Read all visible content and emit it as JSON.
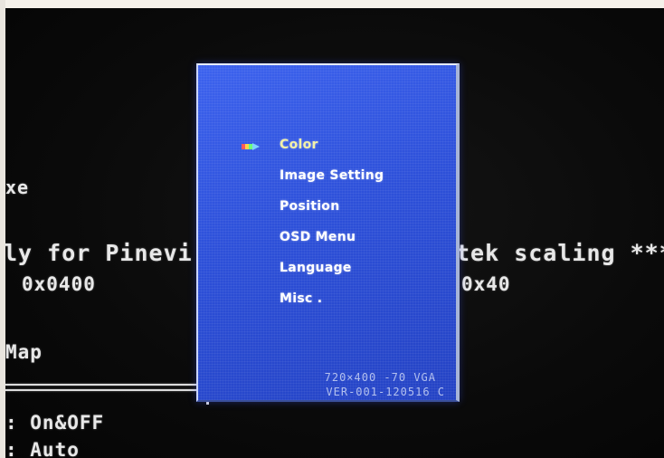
{
  "terminal": {
    "line_exe": "xe",
    "line_pinevi": "ly for Pinevi",
    "line_scaling": "tek scaling ***",
    "value_left": "0x0400",
    "value_right": "0x40",
    "line_map": "Map",
    "line_onoff": ": On&OFF",
    "line_auto": ": Auto"
  },
  "osd": {
    "menu_items": [
      {
        "label": "Color",
        "selected": true
      },
      {
        "label": "Image  Setting",
        "selected": false
      },
      {
        "label": "Position",
        "selected": false
      },
      {
        "label": "OSD Menu",
        "selected": false
      },
      {
        "label": "Language",
        "selected": false
      },
      {
        "label": "Misc .",
        "selected": false
      }
    ],
    "resolution": "720×400  -70  VGA",
    "version": "VER-001-120516 C",
    "colors": {
      "panel": "#2d50d9",
      "selected_text": "#f2f0a8",
      "info_text": "#b3c0ee"
    },
    "selection_icon": "rainbow-arrow-icon"
  }
}
